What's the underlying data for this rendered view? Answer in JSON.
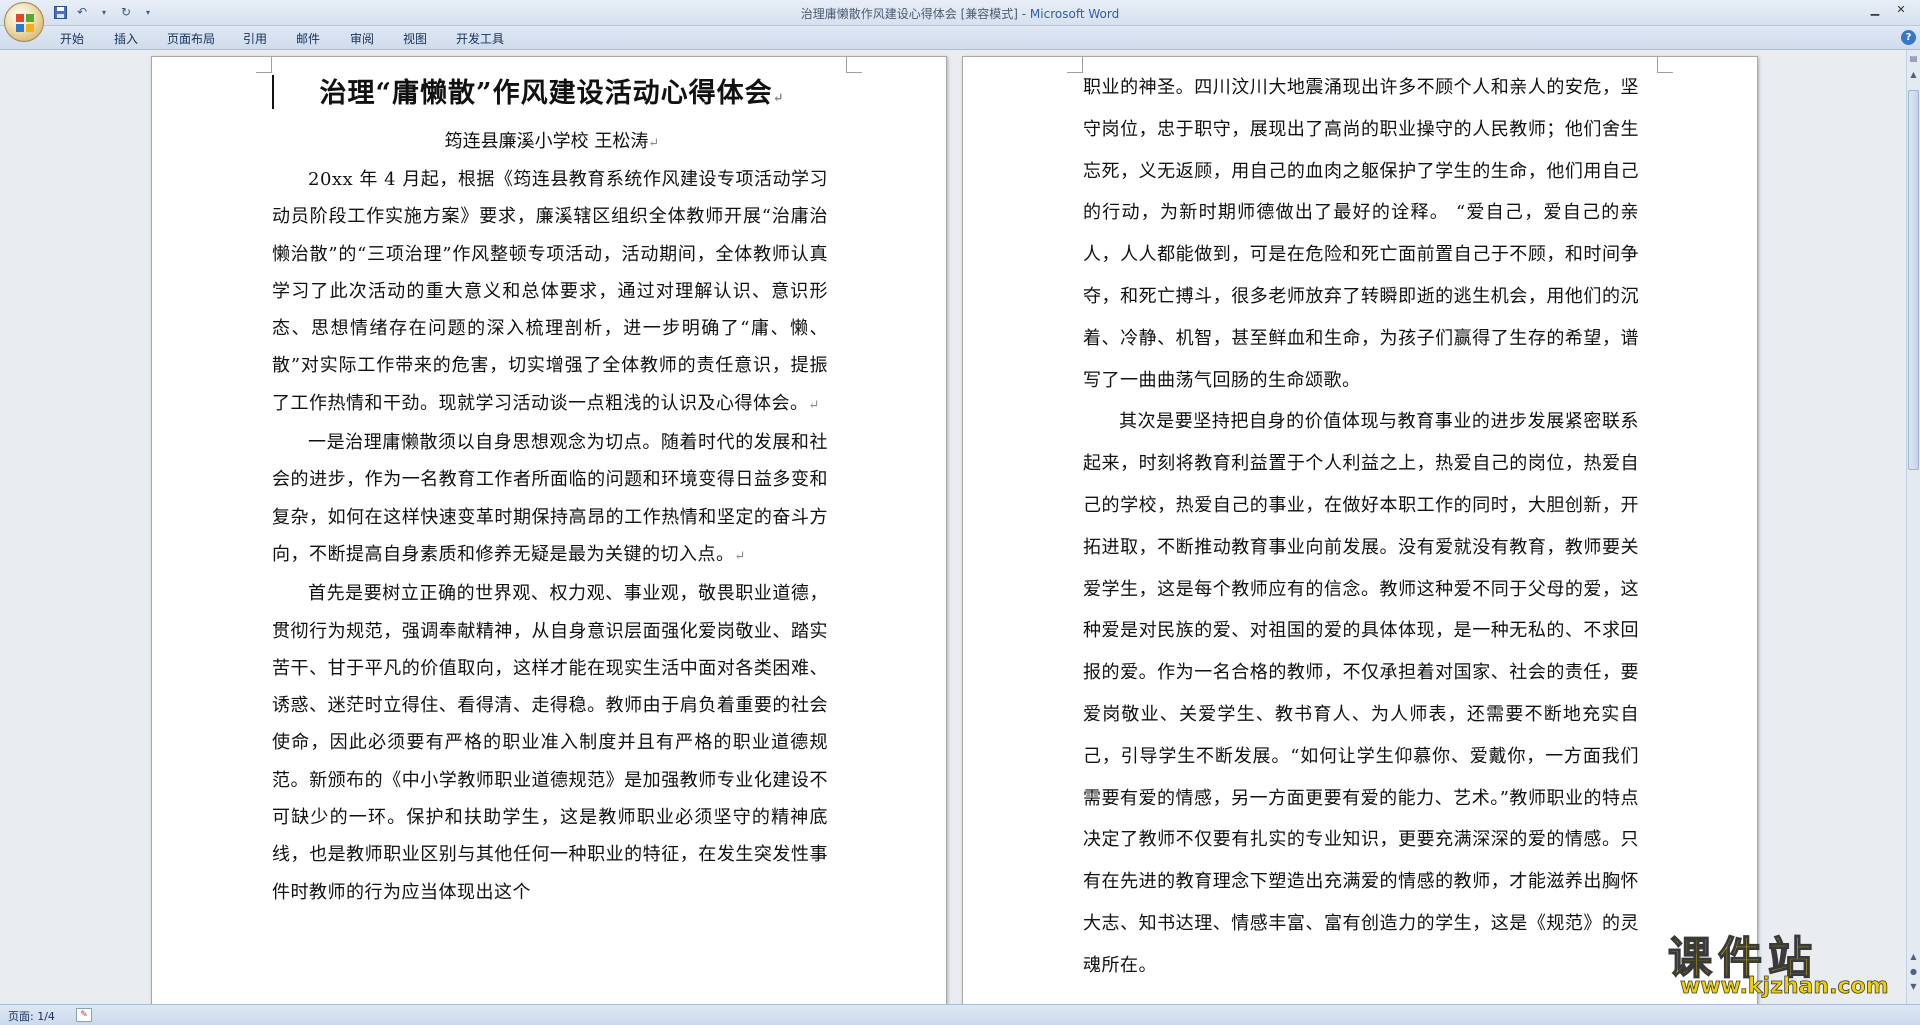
{
  "window": {
    "title": "治理庸懒散作风建设心得体会 [兼容模式] - ",
    "app_name": "Microsoft Word"
  },
  "quick_access": {
    "icons": [
      "save-icon",
      "undo-icon",
      "redo-icon",
      "customize-icon"
    ]
  },
  "ribbon": {
    "tabs": [
      "开始",
      "插入",
      "页面布局",
      "引用",
      "邮件",
      "审阅",
      "视图",
      "开发工具"
    ]
  },
  "document": {
    "title": "治理“庸懒散”作风建设活动心得体会",
    "subtitle": "筠连县廉溪小学校  王松涛",
    "page1_paragraphs": [
      "20xx 年 4 月起，根据《筠连县教育系统作风建设专项活动学习动员阶段工作实施方案》要求，廉溪辖区组织全体教师开展“治庸治懒治散”的“三项治理”作风整顿专项活动，活动期间，全体教师认真学习了此次活动的重大意义和总体要求，通过对理解认识、意识形态、思想情绪存在问题的深入梳理剖析，进一步明确了“庸、懒、散”对实际工作带来的危害，切实增强了全体教师的责任意识，提振了工作热情和干劲。现就学习活动谈一点粗浅的认识及心得体会。",
      "一是治理庸懒散须以自身思想观念为切点。随着时代的发展和社会的进步，作为一名教育工作者所面临的问题和环境变得日益多变和复杂，如何在这样快速变革时期保持高昂的工作热情和坚定的奋斗方向，不断提高自身素质和修养无疑是最为关键的切入点。",
      "首先是要树立正确的世界观、权力观、事业观，敬畏职业道德，贯彻行为规范，强调奉献精神，从自身意识层面强化爱岗敬业、踏实苦干、甘于平凡的价值取向，这样才能在现实生活中面对各类困难、诱惑、迷茫时立得住、看得清、走得稳。教师由于肩负着重要的社会使命，因此必须要有严格的职业准入制度并且有严格的职业道德规范。新颁布的《中小学教师职业道德规范》是加强教师专业化建设不可缺少的一环。保护和扶助学生，这是教师职业必须坚守的精神底线，也是教师职业区别与其他任何一种职业的特征，在发生突发性事件时教师的行为应当体现出这个"
    ],
    "page2_paragraphs": [
      "职业的神圣。四川汶川大地震涌现出许多不顾个人和亲人的安危，坚守岗位，忠于职守，展现出了高尚的职业操守的人民教师；他们舍生忘死，义无返顾，用自己的血肉之躯保护了学生的生命，他们用自己的行动，为新时期师德做出了最好的诠释。 “爱自己，爱自己的亲人，人人都能做到，可是在危险和死亡面前置自己于不顾，和时间争夺，和死亡搏斗，很多老师放弃了转瞬即逝的逃生机会，用他们的沉着、冷静、机智，甚至鲜血和生命，为孩子们赢得了生存的希望，谱写了一曲曲荡气回肠的生命颂歌。",
      "其次是要坚持把自身的价值体现与教育事业的进步发展紧密联系起来，时刻将教育利益置于个人利益之上，热爱自己的岗位，热爱自己的学校，热爱自己的事业，在做好本职工作的同时，大胆创新，开拓进取，不断推动教育事业向前发展。没有爱就没有教育，教师要关爱学生，这是每个教师应有的信念。教师这种爱不同于父母的爱，这种爱是对民族的爱、对祖国的爱的具体体现，是一种无私的、不求回报的爱。作为一名合格的教师，不仅承担着对国家、社会的责任，要爱岗敬业、关爱学生、教书育人、为人师表，还需要不断地充实自己，引导学生不断发展。“如何让学生仰慕你、爱戴你，一方面我们需要有爱的情感，另一方面更要有爱的能力、艺术。”教师职业的特点决定了教师不仅要有扎实的专业知识，更要充满深深的爱的情感。只有在先进的教育理念下塑造出充满爱的情感的教师，才能滋养出胸怀大志、知书达理、情感丰富、富有创造力的学生，这是《规范》的灵魂所在。"
    ],
    "paragraph_mark": "↵"
  },
  "status": {
    "page": "页面: 1/4"
  },
  "watermark": {
    "text_cn": "课件站",
    "url": "www.kjzhan.com"
  }
}
